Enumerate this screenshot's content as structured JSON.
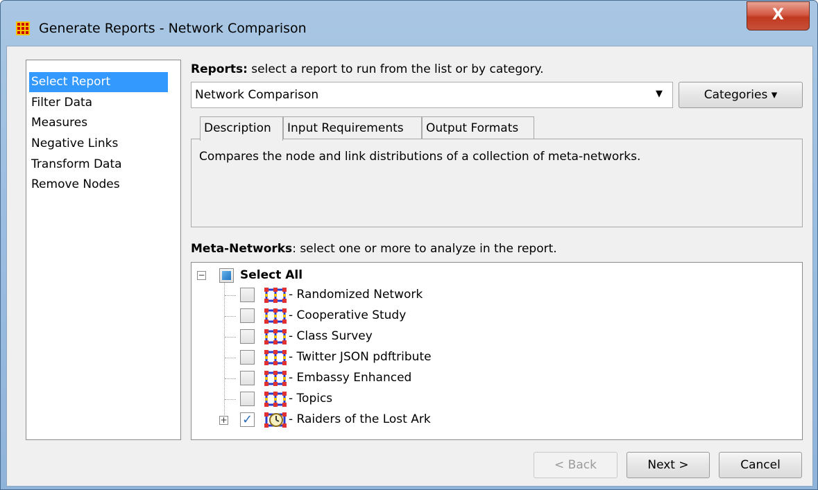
{
  "window": {
    "title": "Generate Reports - Network Comparison",
    "close_label": "X"
  },
  "nav": {
    "items": [
      {
        "label": "Select Report",
        "selected": true
      },
      {
        "label": "Filter Data"
      },
      {
        "label": "Measures"
      },
      {
        "label": "Negative Links"
      },
      {
        "label": "Transform Data"
      },
      {
        "label": "Remove Nodes"
      }
    ]
  },
  "reports": {
    "label_bold": "Reports:",
    "label_rest": " select a report to run from the list or by category.",
    "selected": "Network Comparison",
    "categories_button": "Categories ▾"
  },
  "tabs": [
    {
      "label": "Description",
      "active": true
    },
    {
      "label": "Input Requirements"
    },
    {
      "label": "Output Formats"
    }
  ],
  "description": "Compares the node and link distributions of a collection of meta-networks.",
  "meta_networks": {
    "label_bold": "Meta-Networks",
    "label_rest": ": select one or more to analyze in the report.",
    "select_all": "Select All",
    "items": [
      {
        "label": "Randomized Network",
        "checked": false
      },
      {
        "label": "Cooperative Study",
        "checked": false
      },
      {
        "label": "Class Survey",
        "checked": false
      },
      {
        "label": "Twitter JSON pdftribute",
        "checked": false
      },
      {
        "label": "Embassy Enhanced",
        "checked": false
      },
      {
        "label": "Topics",
        "checked": false
      },
      {
        "label": "Raiders of the Lost Ark",
        "checked": true
      }
    ]
  },
  "buttons": {
    "back": "< Back",
    "next": "Next >",
    "cancel": "Cancel"
  },
  "colors": {
    "selection": "#3399ff",
    "title_gradient_top": "#a9c7e4",
    "close_red": "#c0391f"
  }
}
